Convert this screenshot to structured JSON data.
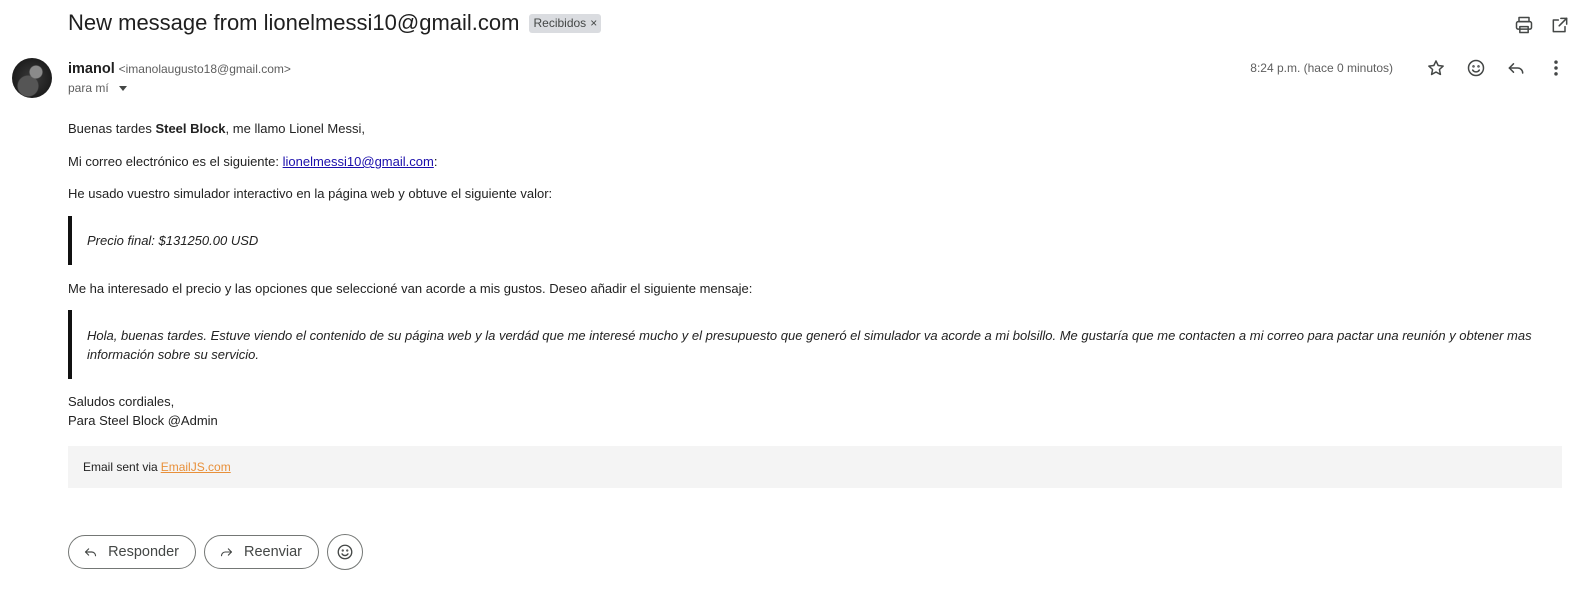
{
  "subject": "New message from lionelmessi10@gmail.com",
  "label_chip": {
    "label": "Recibidos",
    "remove": "×"
  },
  "toolbar_icons": [
    "print-icon",
    "open-in-new-window-icon"
  ],
  "sender": {
    "name": "imanol",
    "email": "<imanolaugusto18@gmail.com>",
    "to": "para mí"
  },
  "meta": {
    "time": "8:24 p.m. (hace 0 minutos)",
    "icons": [
      "star-icon",
      "emoji-icon",
      "reply-icon",
      "more-vert-icon"
    ]
  },
  "body": {
    "greeting_pre": "Buenas tardes ",
    "greeting_bold": "Steel Block",
    "greeting_post": ", me llamo Lionel Messi,",
    "email_line_pre": "Mi correo electrónico es el siguiente: ",
    "email_link": "lionelmessi10@gmail.com",
    "email_line_post": ":",
    "simulator_line": "He usado vuestro simulador interactivo en la página web y obtuve el siguiente valor:",
    "price_quote": "Precio final: $131250.00 USD",
    "interest_line": "Me ha interesado el precio y las opciones que seleccioné van acorde a mis gustos. Deseo añadir el siguiente mensaje:",
    "message_quote": "Hola, buenas tardes. Estuve viendo el contenido de su página web y la verdád que me interesé mucho y el presupuesto que generó el simulador va acorde a mi bolsillo. Me gustaría que me contacten a mi correo para pactar una reunión y obtener mas información sobre su servicio.",
    "closing": "Saludos cordiales,",
    "signature": "Para Steel Block @Admin"
  },
  "footer": {
    "text": "Email sent via",
    "link": "EmailJS.com"
  },
  "actions": {
    "reply": "Responder",
    "forward": "Reenviar"
  }
}
